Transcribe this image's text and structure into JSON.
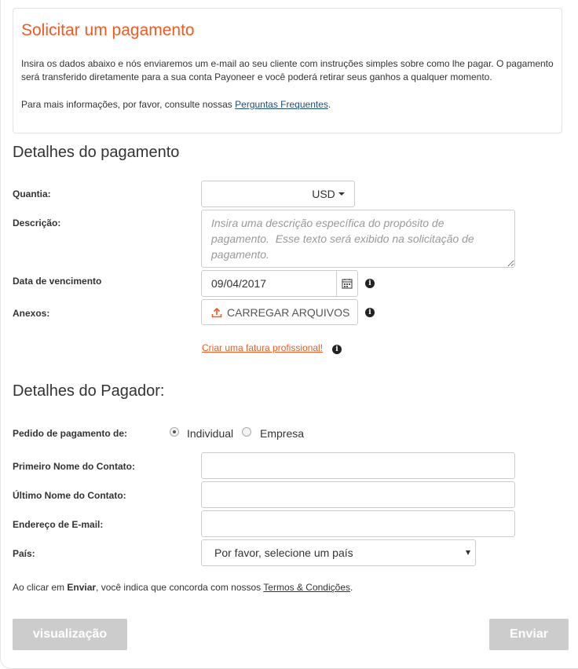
{
  "intro": {
    "title": "Solicitar um pagamento",
    "text": "Insira os dados abaixo e nós enviaremos um e-mail ao seu cliente com instruções simples sobre como lhe pagar. O pagamento será transferido diretamente para a sua conta Payoneer e você poderá retirar seus ganhos a qualquer momento.",
    "more_prefix": "Para mais informações, por favor, consulte nossas ",
    "faq_link": "Perguntas Frequentes",
    "more_suffix": "."
  },
  "payment": {
    "section_title": "Detalhes do pagamento",
    "amount_label": "Quantia:",
    "amount_value": "",
    "currency": "USD",
    "description_label": "Descrição:",
    "description_placeholder": "Insira uma descrição específica do propósito de pagamento.  Esse texto será exibido na solicitação de pagamento.",
    "due_date_label": "Data de vencimento",
    "due_date_value": "09/04/2017",
    "attachments_label": "Anexos:",
    "upload_button": "CARREGAR ARQUIVOS",
    "invoice_link": "Criar uma fatura profissional!"
  },
  "payer": {
    "section_title": "Detalhes do Pagador:",
    "request_from_label": "Pedido de pagamento de:",
    "options": [
      "Individual",
      "Empresa"
    ],
    "selected_option": "Individual",
    "first_name_label": "Primeiro Nome do Contato:",
    "first_name_value": "",
    "last_name_label": "Último Nome do Contato:",
    "last_name_value": "",
    "email_label": "Endereço de E-mail:",
    "email_value": "",
    "country_label": "País:",
    "country_placeholder": "Por favor, selecione um país"
  },
  "terms": {
    "prefix": "Ao clicar em ",
    "action": "Enviar",
    "middle": ", você indica que concorda com nossos ",
    "link": "Termos & Condições",
    "suffix": "."
  },
  "buttons": {
    "preview": "visualização",
    "submit": "Enviar"
  },
  "colors": {
    "accent": "#f15a22",
    "link": "#1f4e79",
    "disabled": "#cccccc"
  }
}
